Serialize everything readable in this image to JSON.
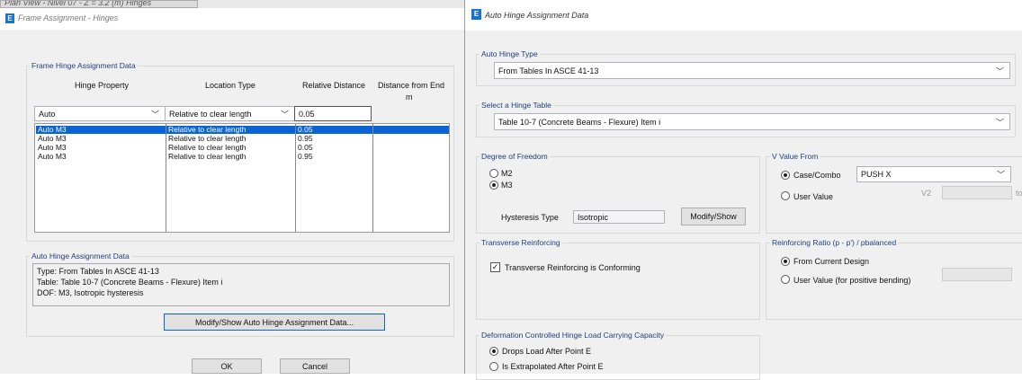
{
  "left": {
    "behind_tab": "Plan View - Nivel 07 - Z = 3.2 (m) Hinges",
    "title": "Frame Assignment - Hinges",
    "hinge_group": {
      "title": "Frame Hinge Assignment Data",
      "headers": [
        "Hinge Property",
        "Location Type",
        "Relative Distance",
        "Distance from End"
      ],
      "unit": "m",
      "input": {
        "property": "Auto",
        "location": "Relative to clear length",
        "distance": "0.05"
      },
      "rows": [
        {
          "property": "Auto  M3",
          "location": "Relative to clear length",
          "distance": "0.05"
        },
        {
          "property": "Auto  M3",
          "location": "Relative to clear length",
          "distance": "0.95"
        },
        {
          "property": "Auto  M3",
          "location": "Relative to clear length",
          "distance": "0.05"
        },
        {
          "property": "Auto  M3",
          "location": "Relative to clear length",
          "distance": "0.95"
        }
      ]
    },
    "auto_group": {
      "title": "Auto Hinge Assignment Data",
      "lines": [
        "Type:  From Tables In ASCE 41-13",
        "Table:  Table 10-7 (Concrete Beams - Flexure) Item i",
        "DOF:  M3, Isotropic hysteresis"
      ]
    },
    "modify_button": "Modify/Show Auto Hinge Assignment Data...",
    "ok": "OK",
    "cancel": "Cancel"
  },
  "right": {
    "title": "Auto Hinge Assignment Data",
    "auto_hinge_type": {
      "title": "Auto Hinge Type",
      "value": "From Tables In ASCE 41-13"
    },
    "hinge_table": {
      "title": "Select a Hinge Table",
      "value": "Table 10-7 (Concrete Beams - Flexure) Item i"
    },
    "dof": {
      "title": "Degree of Freedom",
      "options": [
        "M2",
        "M3"
      ],
      "hysteresis_label": "Hysteresis Type",
      "hysteresis_value": "Isotropic",
      "modify_button": "Modify/Show"
    },
    "v_value": {
      "title": "V Value From",
      "case_combo": "Case/Combo",
      "case_value": "PUSH X",
      "user_value": "User Value",
      "v2_label": "V2",
      "trailing": "to"
    },
    "transverse": {
      "title": "Transverse Reinforcing",
      "checkbox": "Transverse Reinforcing is Conforming"
    },
    "reinforcing_ratio": {
      "title": "Reinforcing Ratio  (p - p') / pbalanced",
      "from_design": "From Current Design",
      "user_value": "User Value (for positive bending)"
    },
    "deformation": {
      "title": "Deformation Controlled Hinge Load Carrying Capacity",
      "opt1": "Drops Load After Point E",
      "opt2": "Is Extrapolated After Point E"
    }
  },
  "colors": {
    "accent": "#0a64d6",
    "dialog_bg": "#f0f0f0",
    "brand_icon": "#1a73c9"
  }
}
